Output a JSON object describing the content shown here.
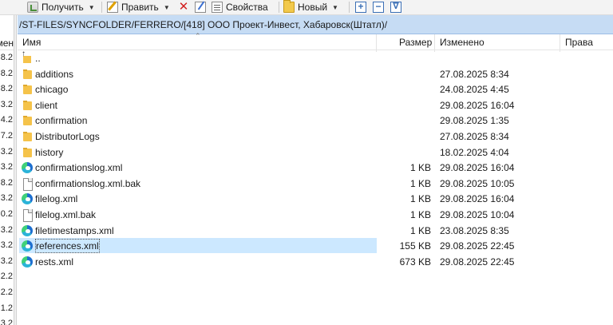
{
  "toolbar": {
    "get_label": "Получить",
    "edit_label": "Править",
    "props_label": "Свойства",
    "new_label": "Новый",
    "add_symbol": "+",
    "remove_symbol": "−",
    "filter_symbol": "∇"
  },
  "left_panel": {
    "header_fragment": "мен",
    "row_fragments": [
      "8.2",
      "8.2",
      "8.2",
      "3.2",
      "4.2",
      "7.2",
      "3.2",
      "3.2",
      "8.2",
      "3.2",
      "0.2",
      "3.2",
      "3.2",
      "3.2",
      "2.2",
      "2.2",
      "1.2",
      "3.2"
    ]
  },
  "path": "/ST-FILES/SYNCFOLDER/FERRERO/[418] ООО Проект-Инвест, Хабаровск(Штатл)/",
  "columns": {
    "name": "Имя",
    "size": "Размер",
    "modified": "Изменено",
    "rights": "Права"
  },
  "files": [
    {
      "name": "..",
      "size": "",
      "modified": "",
      "icon": "parent-folder-icon"
    },
    {
      "name": "additions",
      "size": "",
      "modified": "27.08.2025 8:34",
      "icon": "folder-icon"
    },
    {
      "name": "chicago",
      "size": "",
      "modified": "24.08.2025 4:45",
      "icon": "folder-icon"
    },
    {
      "name": "client",
      "size": "",
      "modified": "29.08.2025 16:04",
      "icon": "folder-icon"
    },
    {
      "name": "confirmation",
      "size": "",
      "modified": "29.08.2025 1:35",
      "icon": "folder-icon"
    },
    {
      "name": "DistributorLogs",
      "size": "",
      "modified": "27.08.2025 8:34",
      "icon": "folder-icon"
    },
    {
      "name": "history",
      "size": "",
      "modified": "18.02.2025 4:04",
      "icon": "folder-icon"
    },
    {
      "name": "confirmationslog.xml",
      "size": "1 KB",
      "modified": "29.08.2025 16:04",
      "icon": "edge-file-icon"
    },
    {
      "name": "confirmationslog.xml.bak",
      "size": "1 KB",
      "modified": "29.08.2025 10:05",
      "icon": "blank-file-icon"
    },
    {
      "name": "filelog.xml",
      "size": "1 KB",
      "modified": "29.08.2025 16:04",
      "icon": "edge-file-icon"
    },
    {
      "name": "filelog.xml.bak",
      "size": "1 KB",
      "modified": "29.08.2025 10:04",
      "icon": "blank-file-icon"
    },
    {
      "name": "filetimestamps.xml",
      "size": "1 KB",
      "modified": "23.08.2025 8:35",
      "icon": "edge-file-icon"
    },
    {
      "name": "references.xml",
      "size": "155 KB",
      "modified": "29.08.2025 22:45",
      "icon": "edge-file-icon",
      "selected": true
    },
    {
      "name": "rests.xml",
      "size": "673 KB",
      "modified": "29.08.2025 22:45",
      "icon": "edge-file-icon"
    }
  ],
  "colors": {
    "path_bar": "#c6dcf4",
    "selection": "#cce8ff",
    "folder": "#f5c34a",
    "delete": "#d21f1f"
  }
}
